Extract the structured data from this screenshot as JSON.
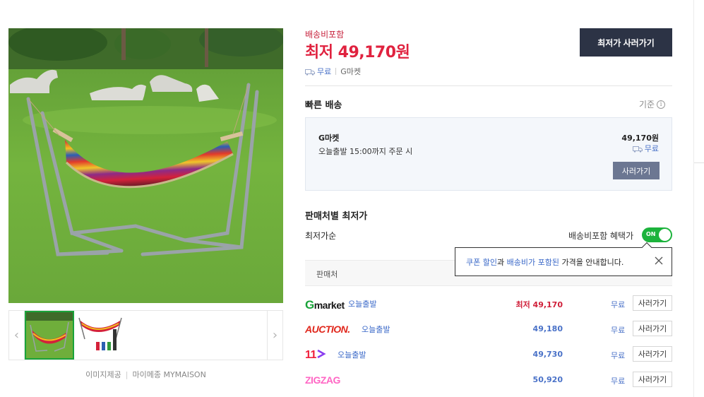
{
  "image": {
    "credit_label": "이미지제공",
    "credit_source": "마이메종 MYMAISON",
    "prev_arrow": "‹",
    "next_arrow": "›"
  },
  "price": {
    "shipping_note": "배송비포함",
    "lowest_label": "최저",
    "lowest_value": "49,170",
    "currency": "원",
    "shipping": "무료",
    "mall": "G마켓",
    "buy_label": "최저가 사러가기"
  },
  "fast_delivery": {
    "title": "빠른 배송",
    "criteria": "기준",
    "seller": "G마켓",
    "info": "오늘출발 15:00까지 주문 시",
    "price": "49,170원",
    "shipping": "무료",
    "buy_label": "사러가기"
  },
  "sellers": {
    "title": "판매처별 최저가",
    "sort_label": "최저가순",
    "toggle_label": "배송비포함 혜택가",
    "toggle_state": "ON",
    "column_header": "판매처",
    "tooltip": {
      "part1": "쿠폰 할인",
      "part2": "과 ",
      "part3": "배송비가 포함된",
      "part4": " 가격을 안내합니다."
    },
    "rows": [
      {
        "logo": "Gmarket",
        "badge": "오늘출발",
        "price_prefix": "최저 ",
        "price": "49,170",
        "shipping": "무료",
        "buy": "사러가기",
        "logo_color": "#1a1a1a"
      },
      {
        "logo": "AUCTION.",
        "badge": "오늘출발",
        "price_prefix": "",
        "price": "49,180",
        "shipping": "무료",
        "buy": "사러가기",
        "logo_color": "#e0261b"
      },
      {
        "logo": "11",
        "badge": "오늘출발",
        "price_prefix": "",
        "price": "49,730",
        "shipping": "무료",
        "buy": "사러가기",
        "logo_color": "#f0203c"
      },
      {
        "logo": "ZIGZAG",
        "badge": "",
        "price_prefix": "",
        "price": "50,920",
        "shipping": "무료",
        "buy": "사러가기",
        "logo_color": "#ff66c4"
      }
    ]
  },
  "colors": {
    "accent_red": "#e0223f",
    "link_blue": "#4a72c8",
    "toggle_green": "#1cb33c",
    "dark_button": "#2c3345"
  }
}
